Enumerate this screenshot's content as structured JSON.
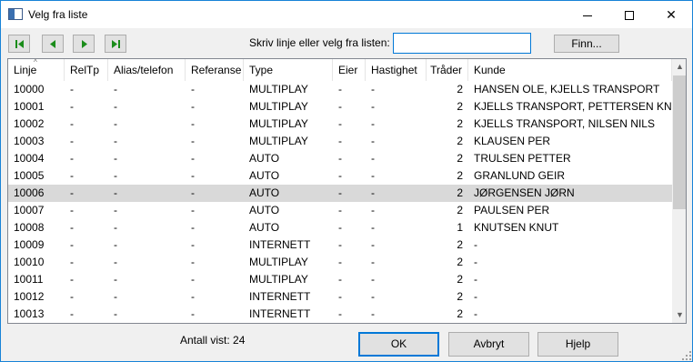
{
  "window": {
    "title": "Velg fra liste",
    "icon": "app-window-icon"
  },
  "titlebar_buttons": {
    "minimize": "minimize-icon",
    "maximize": "maximize-icon",
    "close": "close-icon",
    "close_glyph": "✕"
  },
  "toolbar": {
    "nav_first_icon": "first-record-icon",
    "nav_prev_icon": "previous-record-icon",
    "nav_next_icon": "next-record-icon",
    "nav_last_icon": "last-record-icon",
    "search_label": "Skriv linje eller velg fra listen:",
    "search_value": "",
    "find_button": "Finn..."
  },
  "list": {
    "sort_indicator": "^",
    "columns": [
      "Linje",
      "RelTp",
      "Alias/telefon",
      "Referanse",
      "Type",
      "Eier",
      "Hastighet",
      "Tråder",
      "Kunde"
    ],
    "selected_index": 6,
    "rows": [
      [
        "10000",
        "-",
        "-",
        "-",
        "MULTIPLAY",
        "-",
        "-",
        "2",
        "HANSEN OLE, KJELLS TRANSPORT"
      ],
      [
        "10001",
        "-",
        "-",
        "-",
        "MULTIPLAY",
        "-",
        "-",
        "2",
        "KJELLS TRANSPORT, PETTERSEN KNUT"
      ],
      [
        "10002",
        "-",
        "-",
        "-",
        "MULTIPLAY",
        "-",
        "-",
        "2",
        "KJELLS TRANSPORT, NILSEN NILS"
      ],
      [
        "10003",
        "-",
        "-",
        "-",
        "MULTIPLAY",
        "-",
        "-",
        "2",
        "KLAUSEN PER"
      ],
      [
        "10004",
        "-",
        "-",
        "-",
        "AUTO",
        "-",
        "-",
        "2",
        "TRULSEN PETTER"
      ],
      [
        "10005",
        "-",
        "-",
        "-",
        "AUTO",
        "-",
        "-",
        "2",
        "GRANLUND GEIR"
      ],
      [
        "10006",
        "-",
        "-",
        "-",
        "AUTO",
        "-",
        "-",
        "2",
        "JØRGENSEN JØRN"
      ],
      [
        "10007",
        "-",
        "-",
        "-",
        "AUTO",
        "-",
        "-",
        "2",
        "PAULSEN PER"
      ],
      [
        "10008",
        "-",
        "-",
        "-",
        "AUTO",
        "-",
        "-",
        "1",
        "KNUTSEN KNUT"
      ],
      [
        "10009",
        "-",
        "-",
        "-",
        "INTERNETT",
        "-",
        "-",
        "2",
        "-"
      ],
      [
        "10010",
        "-",
        "-",
        "-",
        "MULTIPLAY",
        "-",
        "-",
        "2",
        "-"
      ],
      [
        "10011",
        "-",
        "-",
        "-",
        "MULTIPLAY",
        "-",
        "-",
        "2",
        "-"
      ],
      [
        "10012",
        "-",
        "-",
        "-",
        "INTERNETT",
        "-",
        "-",
        "2",
        "-"
      ],
      [
        "10013",
        "-",
        "-",
        "-",
        "INTERNETT",
        "-",
        "-",
        "2",
        "-"
      ]
    ]
  },
  "scrollbar": {
    "up_glyph": "▲",
    "down_glyph": "▼"
  },
  "footer": {
    "count_label": "Antall vist: 24",
    "ok_button": "OK",
    "cancel_button": "Avbryt",
    "help_button": "Hjelp"
  },
  "colors": {
    "accent": "#0078d7",
    "selected_row": "#d9d9d9",
    "nav_arrow": "#1a8c1a"
  }
}
